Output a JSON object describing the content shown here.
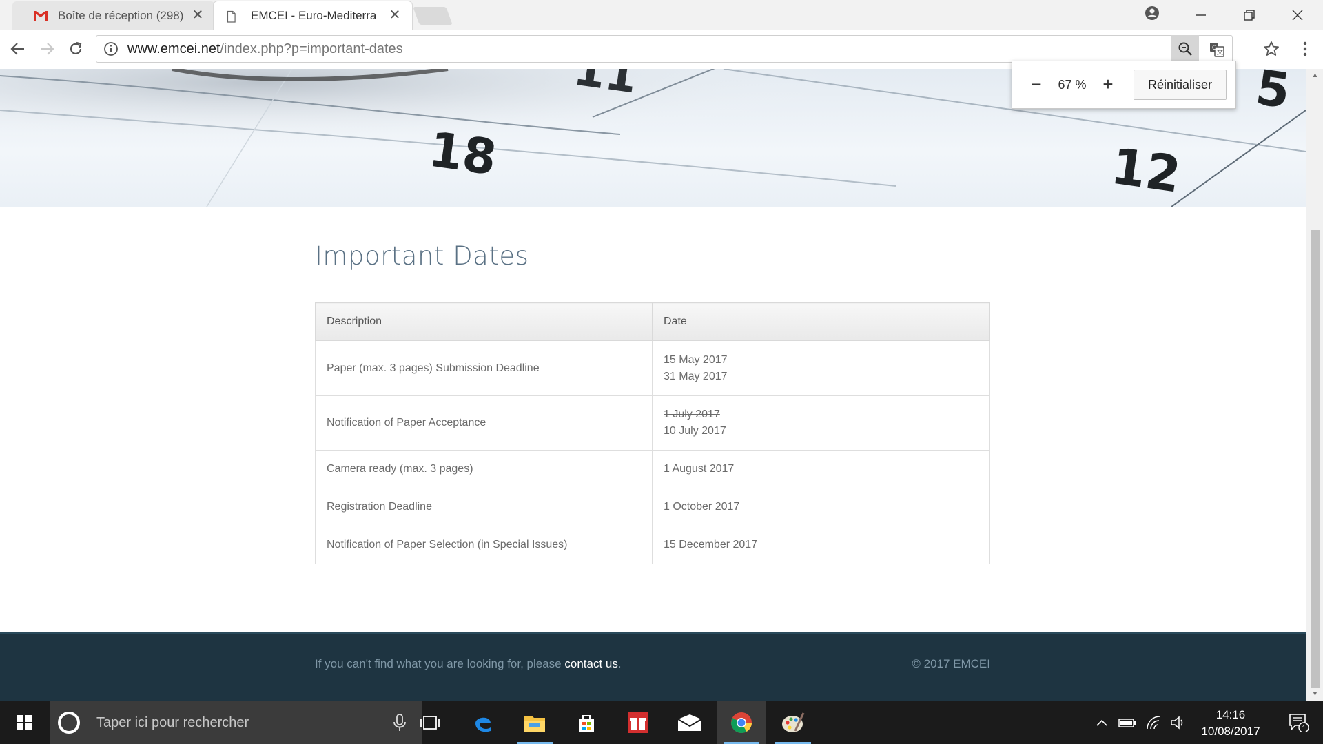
{
  "browser": {
    "tabs": [
      {
        "title": "Boîte de réception (298)",
        "icon": "gmail-icon",
        "active": false
      },
      {
        "title": "EMCEI - Euro-Mediterran",
        "icon": "page-icon",
        "active": true
      }
    ],
    "url": {
      "domain": "www.emcei.net",
      "path": "/index.php?p=important-dates"
    },
    "zoom": {
      "value": "67 %",
      "minus": "−",
      "plus": "+",
      "reset_label": "Réinitialiser"
    }
  },
  "page": {
    "heading": "Important Dates",
    "table": {
      "headers": [
        "Description",
        "Date"
      ],
      "rows": [
        {
          "description": "Paper (max. 3 pages) Submission Deadline",
          "old_date": "15 May 2017",
          "date": "31 May 2017"
        },
        {
          "description": "Notification of Paper Acceptance",
          "old_date": "1 July 2017",
          "date": "10 July 2017"
        },
        {
          "description": "Camera ready (max. 3 pages)",
          "date": "1 August 2017"
        },
        {
          "description": "Registration Deadline",
          "date": "1 October 2017"
        },
        {
          "description": "Notification of Paper Selection (in Special Issues)",
          "date": "15 December 2017"
        }
      ]
    },
    "hero": {
      "numbers": [
        "18",
        "11",
        "12",
        "5"
      ]
    },
    "footer": {
      "text_before": "If you can't find what you are looking for, please ",
      "link": "contact us",
      "text_after": ".",
      "copyright": "© 2017 EMCEI"
    }
  },
  "taskbar": {
    "search_placeholder": "Taper ici pour rechercher",
    "apps": [
      "task-view-icon",
      "edge-icon",
      "file-explorer-icon",
      "store-icon",
      "gift-app-icon",
      "mail-icon",
      "chrome-icon",
      "paint-icon"
    ],
    "time": "14:16",
    "date": "10/08/2017",
    "notification_count": "1"
  },
  "colors": {
    "heading": "#5a7184",
    "footer_bg": "#1e3441",
    "taskbar_bg": "#1b1b1b"
  }
}
